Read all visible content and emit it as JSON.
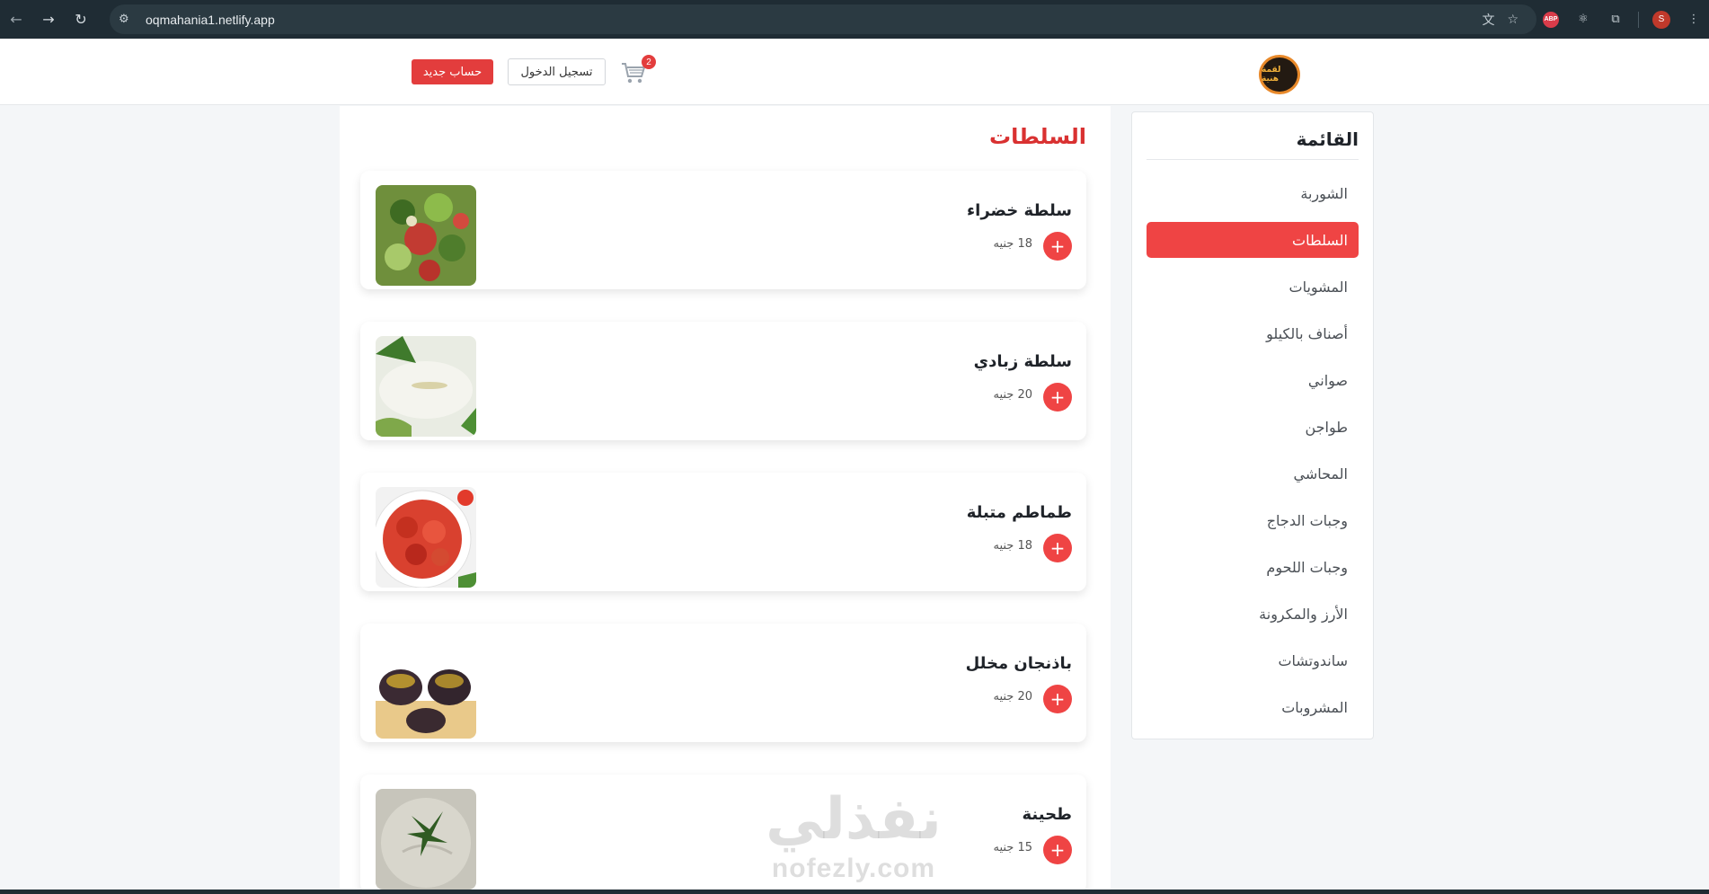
{
  "browser": {
    "url": "oqmahania1.netlify.app",
    "profile_initial": "S",
    "abp_label": "ABP"
  },
  "header": {
    "register_label": "حساب جديد",
    "login_label": "تسجيل الدخول",
    "cart_count": "2",
    "logo_text": "لقمة هنية"
  },
  "section": {
    "title": "السلطات"
  },
  "products": [
    {
      "name": "سلطة خضراء",
      "price": "18 جنيه",
      "add_label": "+"
    },
    {
      "name": "سلطة زبادي",
      "price": "20 جنيه",
      "add_label": "+"
    },
    {
      "name": "طماطم متبلة",
      "price": "18 جنيه",
      "add_label": "+"
    },
    {
      "name": "باذنجان مخلل",
      "price": "20 جنيه",
      "add_label": "+"
    },
    {
      "name": "طحينة",
      "price": "15 جنيه",
      "add_label": "+"
    }
  ],
  "sidebar": {
    "title": "القائمة",
    "items": [
      {
        "label": "الشوربة"
      },
      {
        "label": "السلطات"
      },
      {
        "label": "المشويات"
      },
      {
        "label": "أصناف بالكيلو"
      },
      {
        "label": "صواني"
      },
      {
        "label": "طواجن"
      },
      {
        "label": "المحاشي"
      },
      {
        "label": "وجبات الدجاج"
      },
      {
        "label": "وجبات اللحوم"
      },
      {
        "label": "الأرز والمكرونة"
      },
      {
        "label": "ساندوتشات"
      },
      {
        "label": "المشروبات"
      }
    ],
    "active_index": 1
  },
  "watermark": {
    "arabic": "نفذلي",
    "latin": "nofezly.com"
  },
  "colors": {
    "accent": "#ef4444",
    "title_red": "#d93131",
    "browser_bar": "#1f2c34"
  }
}
